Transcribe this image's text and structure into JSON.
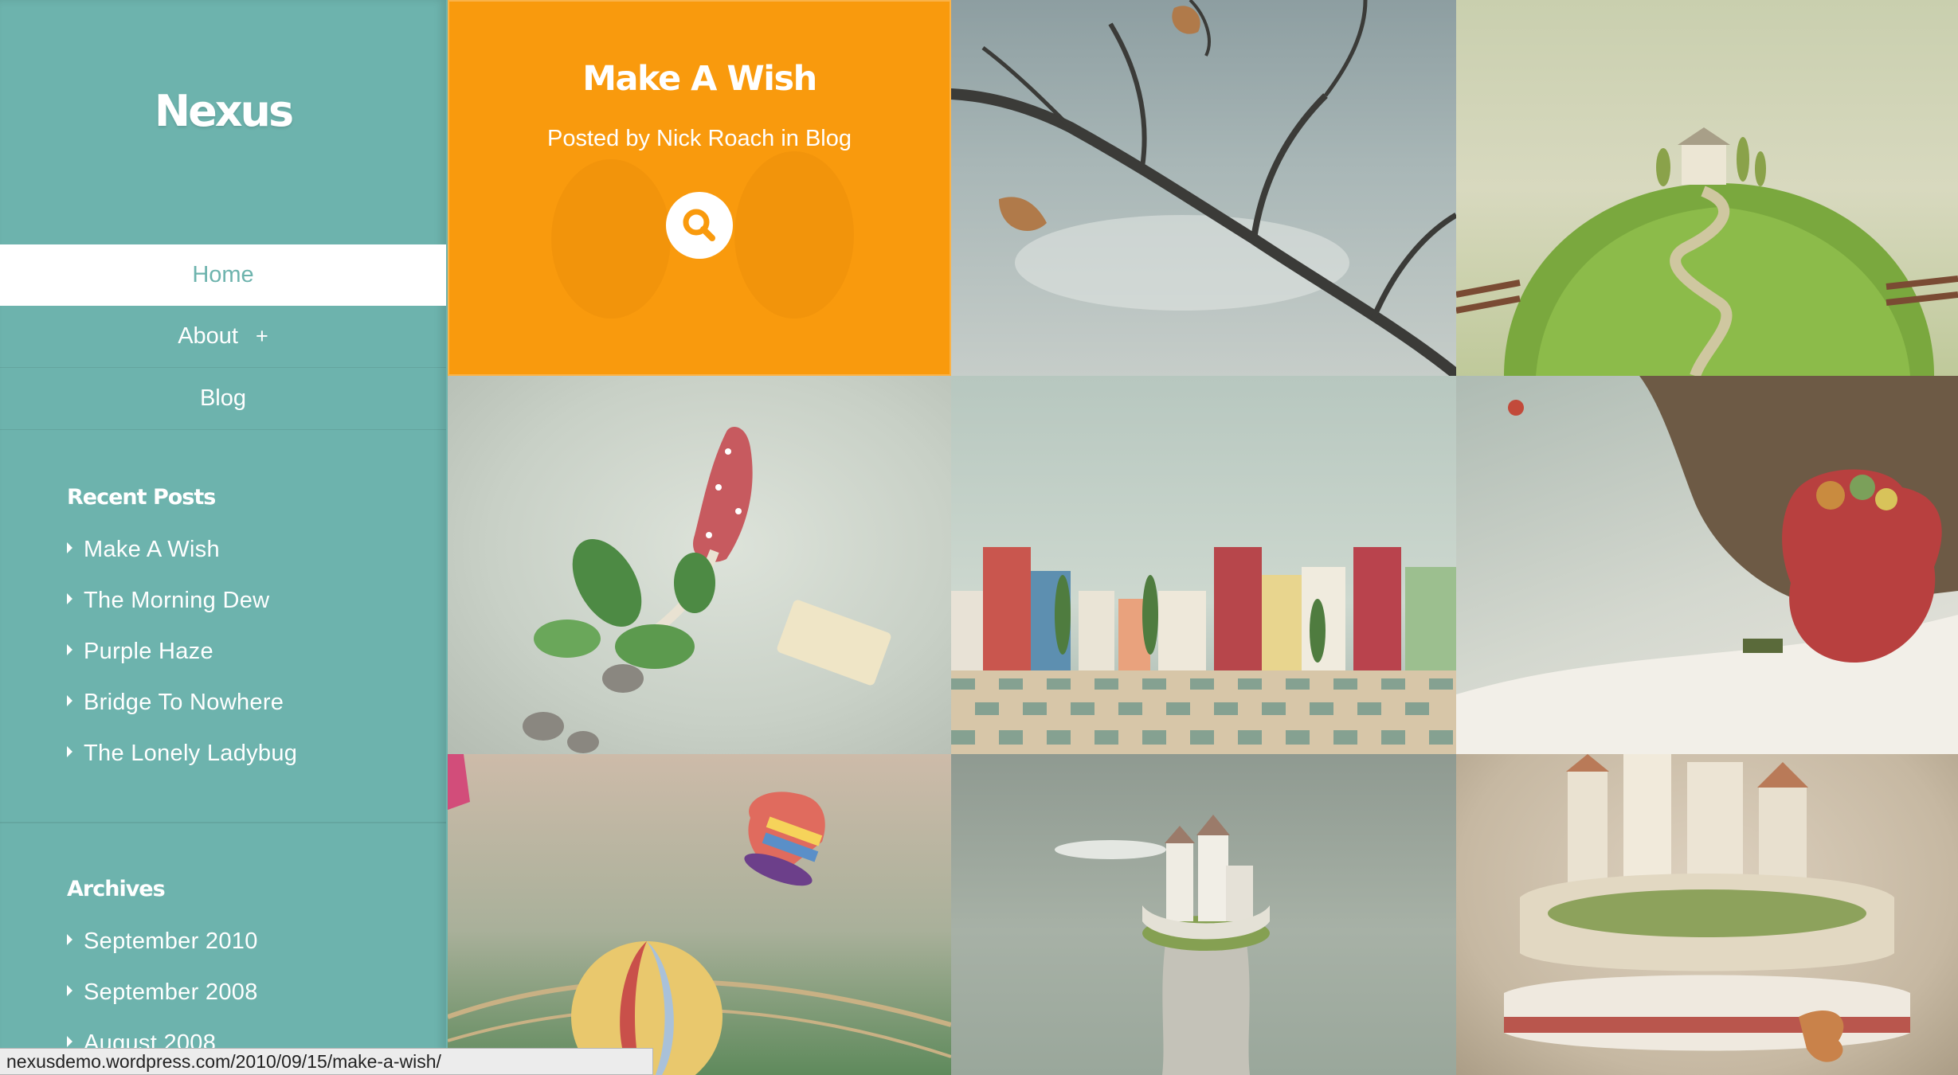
{
  "site": {
    "title": "Nexus"
  },
  "nav": [
    {
      "label": "Home",
      "active": true
    },
    {
      "label": "About",
      "has_children": true,
      "expand_symbol": "+"
    },
    {
      "label": "Blog"
    }
  ],
  "recent_posts": {
    "title": "Recent Posts",
    "items": [
      "Make A Wish",
      "The Morning Dew",
      "Purple Haze",
      "Bridge To Nowhere",
      "The Lonely Ladybug"
    ]
  },
  "archives": {
    "title": "Archives",
    "items": [
      "September 2010",
      "September 2008",
      "August 2008"
    ]
  },
  "featured_post": {
    "title": "Make A Wish",
    "meta": "Posted by Nick Roach in Blog",
    "icon": "search-icon",
    "color": "#f99a0d"
  },
  "colors": {
    "sidebar": "#6db3ad",
    "accent": "#f99a0d"
  },
  "status_bar": {
    "url": "nexusdemo.wordpress.com/2010/09/15/make-a-wish/"
  }
}
